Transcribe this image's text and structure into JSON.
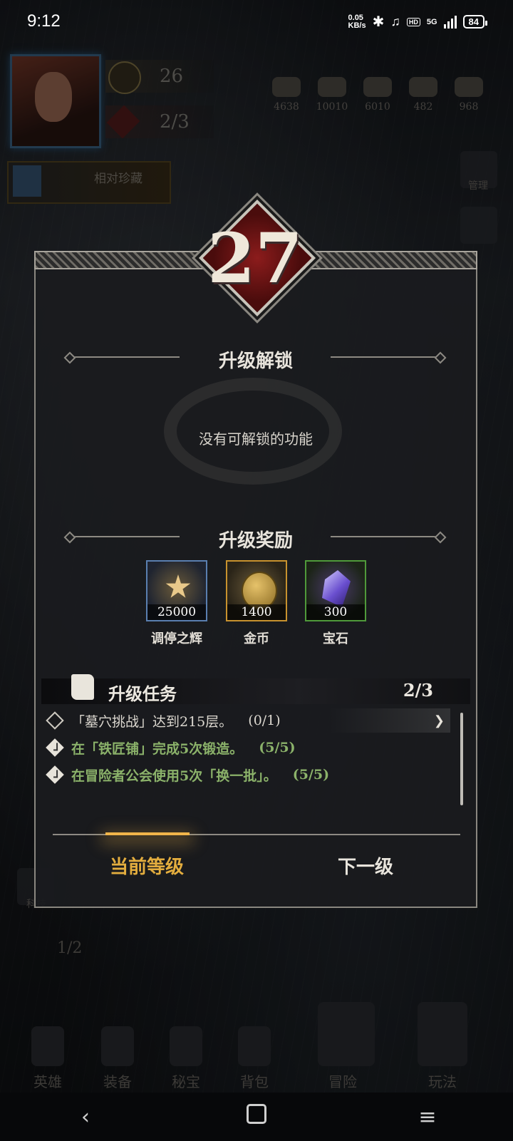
{
  "status_bar": {
    "time": "9:12",
    "net_speed_value": "0.05",
    "net_speed_unit": "KB/s",
    "network": "5G",
    "battery": "84"
  },
  "hud": {
    "player_level": "26",
    "slots": "2/3",
    "resources": [
      "4638",
      "10010",
      "6010",
      "482",
      "968"
    ],
    "event_label": "相对珍藏",
    "side_labels": [
      "管理",
      "",
      "",
      "科技"
    ],
    "bottom_counter": "1/2"
  },
  "modal": {
    "level": "27",
    "unlock_title": "升级解锁",
    "unlock_empty": "没有可解锁的功能",
    "reward_title": "升级奖励",
    "rewards": [
      {
        "qty": "25000",
        "name": "调停之辉",
        "icon": "radiance-star-icon"
      },
      {
        "qty": "1400",
        "name": "金币",
        "icon": "gold-coin-icon"
      },
      {
        "qty": "300",
        "name": "宝石",
        "icon": "gem-icon"
      }
    ],
    "task_title": "升级任务",
    "task_count": "2/3",
    "tasks": [
      {
        "text": "「墓穴挑战」达到215层。",
        "progress": "(0/1)",
        "done": false
      },
      {
        "text": "在「铁匠铺」完成5次锻造。",
        "progress": "(5/5)",
        "done": true
      },
      {
        "text": "在冒险者公会使用5次「换一批」。",
        "progress": "(5/5)",
        "done": true
      }
    ],
    "tab_current": "当前等级",
    "tab_next": "下一级"
  },
  "bottom_nav": [
    "英雄",
    "装备",
    "秘宝",
    "背包",
    "冒险",
    "玩法"
  ],
  "colors": {
    "accent_gold": "#e3ad3e",
    "task_done_green": "#8bb26a",
    "badge_red": "#8c1c1c"
  }
}
